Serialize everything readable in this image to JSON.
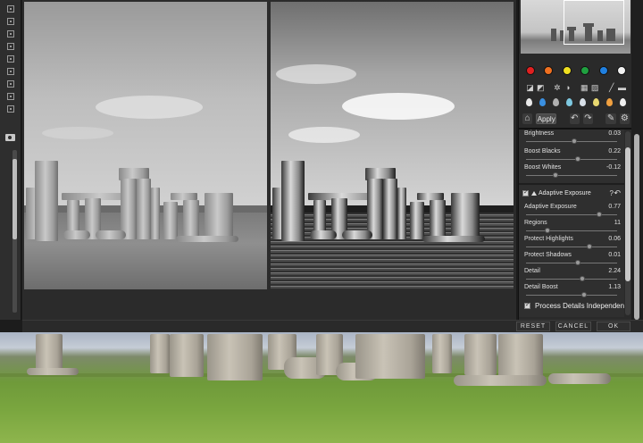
{
  "window": {
    "left_toolbar": {
      "tool_icons": [
        "grid-icon",
        "grid-icon",
        "grid-icon",
        "grid-icon",
        "grid-icon",
        "grid-icon",
        "grid-icon",
        "grid-icon",
        "grid-icon",
        "grid-icon"
      ],
      "camera_icon": "camera-icon"
    }
  },
  "right_panel": {
    "preset_colors": [
      "#e02020",
      "#f07020",
      "#f0e020",
      "#20a040",
      "#2080e0",
      "#f2f2f2"
    ],
    "apply_label": "Apply",
    "sliders_top": [
      {
        "label": "Brightness",
        "value": "0.03",
        "pos": 0.5
      },
      {
        "label": "Boost Blacks",
        "value": "0.22",
        "pos": 0.55
      },
      {
        "label": "Boost Whites",
        "value": "-0.12",
        "pos": 0.3
      }
    ],
    "section": {
      "title": "Adaptive Exposure",
      "help": "?",
      "reset_icon": "undo-icon"
    },
    "sliders_section": [
      {
        "label": "Adaptive Exposure",
        "value": "0.77",
        "pos": 0.78
      },
      {
        "label": "Regions",
        "value": "11",
        "pos": 0.22
      },
      {
        "label": "Protect Highlights",
        "value": "0.06",
        "pos": 0.68
      },
      {
        "label": "Protect Shadows",
        "value": "0.01",
        "pos": 0.55
      },
      {
        "label": "Detail",
        "value": "2.24",
        "pos": 0.58
      },
      {
        "label": "Detail Boost",
        "value": "1.13",
        "pos": 0.6
      }
    ],
    "process_details_label": "Process Details Independently"
  },
  "footer": {
    "reset_label": "RESET",
    "cancel_label": "CANCEL",
    "ok_label": "OK"
  }
}
